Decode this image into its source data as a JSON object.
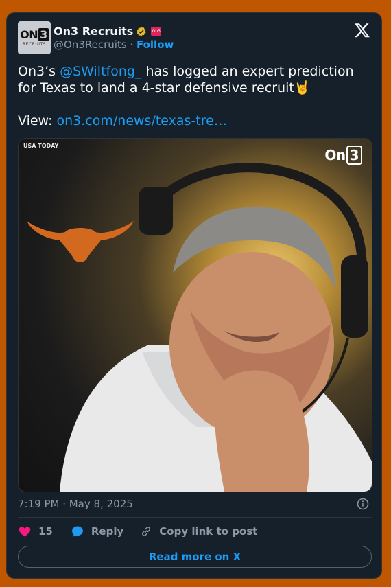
{
  "author": {
    "name": "On3 Recruits",
    "handle": "@On3Recruits",
    "separator": "·",
    "follow_label": "Follow",
    "avatar_logo": "ON",
    "avatar_logo_digit": "3",
    "avatar_sub": "RECRUITS",
    "affiliate_badge": "On3"
  },
  "tweet": {
    "prefix": "On3’s ",
    "mention": "@SWiltfong_",
    "body": " has logged an expert prediction for Texas to land a 4-star defensive recruit",
    "emoji": "🤘",
    "view_label": "View: ",
    "link": "on3.com/news/texas-tre…"
  },
  "media": {
    "credit": "USA TODAY",
    "brand": "On",
    "brand_digit": "3"
  },
  "meta": {
    "timestamp": "7:19 PM · May 8, 2025"
  },
  "actions": {
    "likes": "15",
    "reply_label": "Reply",
    "copy_label": "Copy link to post"
  },
  "read_more_label": "Read more on X",
  "colors": {
    "page_bg": "#bf5700",
    "card_bg": "#15202b",
    "accent": "#1d9bf0",
    "like": "#f91880",
    "longhorn": "#d2691e"
  }
}
